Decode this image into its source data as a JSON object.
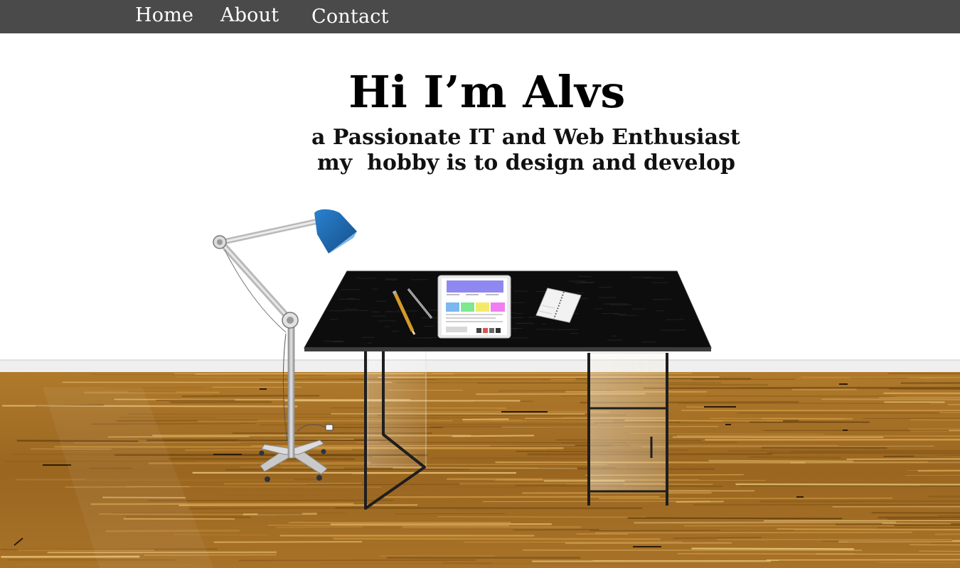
{
  "nav": {
    "items": [
      {
        "label": "Home"
      },
      {
        "label": "About"
      },
      {
        "label": "Contact"
      }
    ]
  },
  "hero": {
    "title": "Hi I’m Alvs",
    "subtitle_line1": "a Passionate IT and Web Enthusiast",
    "subtitle_line2": "my  hobby is to design and develop"
  },
  "scene": {
    "objects": [
      "desk-lamp",
      "glass-desk",
      "tablet",
      "pencil",
      "stylus",
      "notebook",
      "wooden-floor"
    ]
  },
  "colors": {
    "nav_bg": "#4a4a4a",
    "nav_text": "#ffffff",
    "lamp_shade": "#1f6db3",
    "desk_top": "#0d0d0d",
    "floor": "#9a6a22"
  }
}
